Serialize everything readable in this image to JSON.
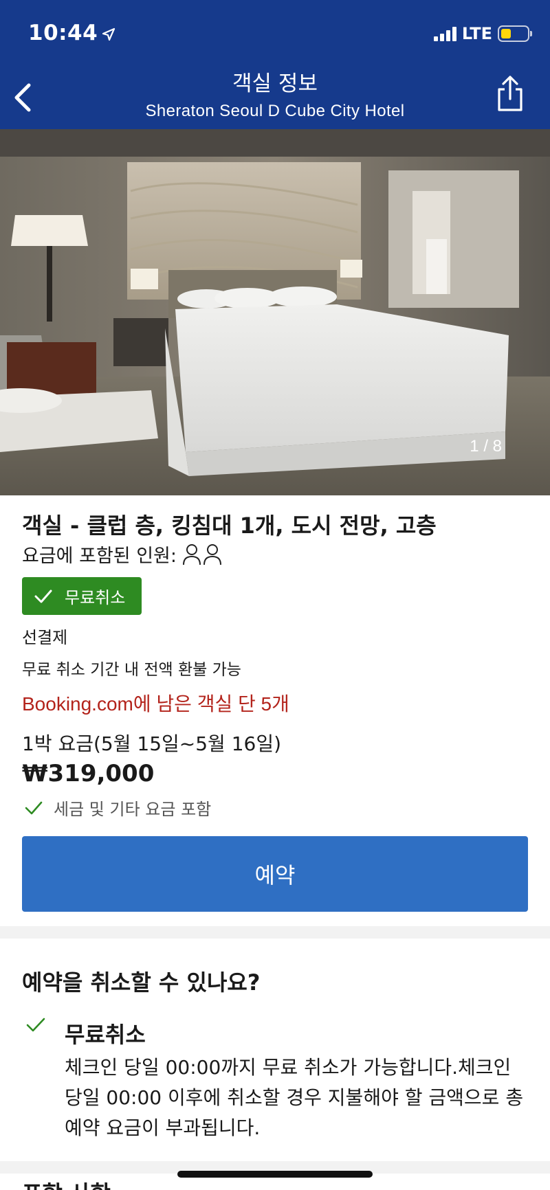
{
  "status_bar": {
    "time": "10:44",
    "network": "LTE"
  },
  "header": {
    "title": "객실 정보",
    "subtitle": "Sheraton Seoul D Cube City Hotel"
  },
  "photo": {
    "counter": "1 / 8"
  },
  "room": {
    "title": "객실 - 클럽 층, 킹침대 1개, 도시 전망, 고층",
    "guests_label": "요금에 포함된 인원:",
    "free_cancel_badge": "무료취소",
    "payment_type": "선결제",
    "refund_note": "무료 취소 기간 내 전액 환불 가능",
    "rooms_left": "Booking.com에 남은 객실 단 5개",
    "night_rate_label": "1박 요금(5월 15일~5월 16일)",
    "price": "₩319,000",
    "tax_note": "세금 및 기타 요금 포함",
    "book_button": "예약"
  },
  "cancellation": {
    "heading": "예약을 취소할 수 있나요?",
    "subheading": "무료취소",
    "body": "체크인 당일 00:00까지 무료 취소가 가능합니다.체크인 당일 00:00 이후에 취소할 경우 지불해야 할 금액으로 총 예약 요금이 부과됩니다."
  },
  "next_section": {
    "heading": "포함 사항"
  },
  "colors": {
    "header_bg": "#163a8c",
    "badge_green": "#2e8b22",
    "book_button_blue": "#2f6fc3",
    "urgency_red": "#b3231b"
  },
  "icons": {
    "back": "chevron-left-icon",
    "share": "share-icon",
    "check": "check-icon",
    "guest": "person-icon"
  }
}
